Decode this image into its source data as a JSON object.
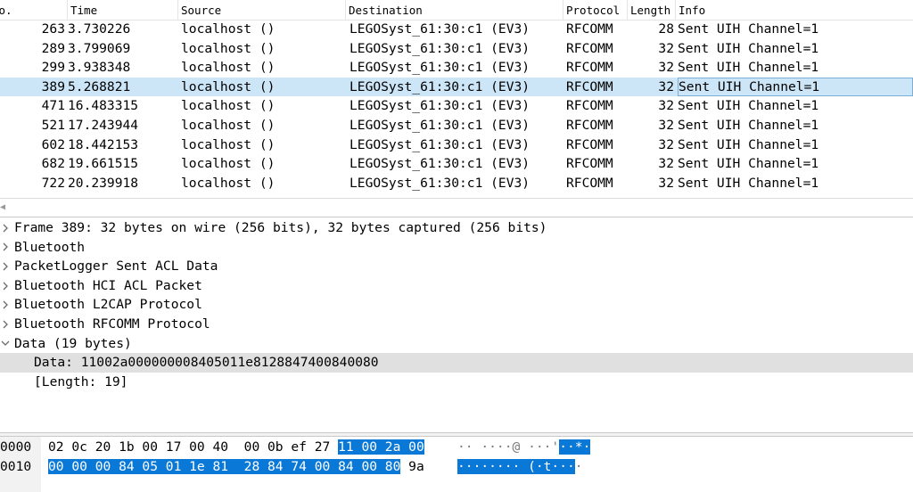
{
  "packet_list": {
    "columns": [
      "No.",
      "Time",
      "Source",
      "Destination",
      "Protocol",
      "Length",
      "Info"
    ],
    "rows": [
      {
        "no": "263",
        "time": "3.730226",
        "source": "localhost ()",
        "destination": "LEGOSyst_61:30:c1 (EV3)",
        "protocol": "RFCOMM",
        "length": "28",
        "info": "Sent UIH Channel=1",
        "selected": false
      },
      {
        "no": "289",
        "time": "3.799069",
        "source": "localhost ()",
        "destination": "LEGOSyst_61:30:c1 (EV3)",
        "protocol": "RFCOMM",
        "length": "32",
        "info": "Sent UIH Channel=1",
        "selected": false
      },
      {
        "no": "299",
        "time": "3.938348",
        "source": "localhost ()",
        "destination": "LEGOSyst_61:30:c1 (EV3)",
        "protocol": "RFCOMM",
        "length": "32",
        "info": "Sent UIH Channel=1",
        "selected": false
      },
      {
        "no": "389",
        "time": "5.268821",
        "source": "localhost ()",
        "destination": "LEGOSyst_61:30:c1 (EV3)",
        "protocol": "RFCOMM",
        "length": "32",
        "info": "Sent UIH Channel=1",
        "selected": true
      },
      {
        "no": "471",
        "time": "16.483315",
        "source": "localhost ()",
        "destination": "LEGOSyst_61:30:c1 (EV3)",
        "protocol": "RFCOMM",
        "length": "32",
        "info": "Sent UIH Channel=1",
        "selected": false
      },
      {
        "no": "521",
        "time": "17.243944",
        "source": "localhost ()",
        "destination": "LEGOSyst_61:30:c1 (EV3)",
        "protocol": "RFCOMM",
        "length": "32",
        "info": "Sent UIH Channel=1",
        "selected": false
      },
      {
        "no": "602",
        "time": "18.442153",
        "source": "localhost ()",
        "destination": "LEGOSyst_61:30:c1 (EV3)",
        "protocol": "RFCOMM",
        "length": "32",
        "info": "Sent UIH Channel=1",
        "selected": false
      },
      {
        "no": "682",
        "time": "19.661515",
        "source": "localhost ()",
        "destination": "LEGOSyst_61:30:c1 (EV3)",
        "protocol": "RFCOMM",
        "length": "32",
        "info": "Sent UIH Channel=1",
        "selected": false
      },
      {
        "no": "722",
        "time": "20.239918",
        "source": "localhost ()",
        "destination": "LEGOSyst_61:30:c1 (EV3)",
        "protocol": "RFCOMM",
        "length": "32",
        "info": "Sent UIH Channel=1",
        "selected": false
      }
    ],
    "selected_row_color": "#cde6f7"
  },
  "details": {
    "items": [
      {
        "label": "Frame 389: 32 bytes on wire (256 bits), 32 bytes captured (256 bits)",
        "arrow": "collapsed",
        "level": 0,
        "selected": false
      },
      {
        "label": "Bluetooth",
        "arrow": "collapsed",
        "level": 0,
        "selected": false
      },
      {
        "label": "PacketLogger Sent ACL Data",
        "arrow": "collapsed",
        "level": 0,
        "selected": false
      },
      {
        "label": "Bluetooth HCI ACL Packet",
        "arrow": "collapsed",
        "level": 0,
        "selected": false
      },
      {
        "label": "Bluetooth L2CAP Protocol",
        "arrow": "collapsed",
        "level": 0,
        "selected": false
      },
      {
        "label": "Bluetooth RFCOMM Protocol",
        "arrow": "collapsed",
        "level": 0,
        "selected": false
      },
      {
        "label": "Data (19 bytes)",
        "arrow": "expanded",
        "level": 0,
        "selected": false
      },
      {
        "label": "Data: 11002a000000008405011e8128847400840080",
        "arrow": "none",
        "level": 1,
        "selected": true
      },
      {
        "label": "[Length: 19]",
        "arrow": "none",
        "level": 1,
        "selected": false
      }
    ],
    "icons": {
      "collapsed": "chevron-right-icon",
      "expanded": "chevron-down-icon"
    }
  },
  "hex": {
    "rows": [
      {
        "offset": "0000",
        "bytes_plain": "02 0c 20 1b 00 17 00 40  00 0b ef 27 ",
        "bytes_hl": "11 00 2a 00",
        "bytes_trail": "",
        "ascii_plain": "·· ····@ ···'",
        "ascii_hl": "··*·",
        "ascii_trail": ""
      },
      {
        "offset": "0010",
        "bytes_plain": "",
        "bytes_hl": "00 00 00 84 05 01 1e 81  28 84 74 00 84 00 80",
        "bytes_trail": " 9a",
        "ascii_plain": "",
        "ascii_hl": "········ (·t···",
        "ascii_trail": "·"
      }
    ],
    "highlight_color": "#0a78d7"
  }
}
